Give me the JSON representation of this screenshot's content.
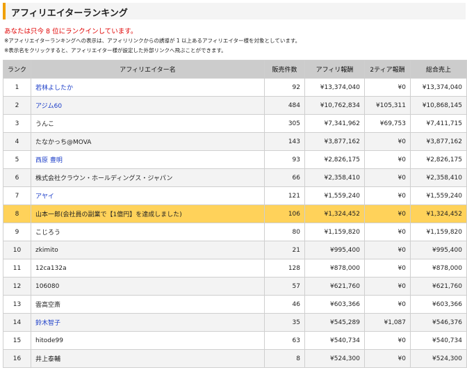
{
  "header": {
    "title": "アフィリエイターランキング",
    "rank_message": "あなたは只今 8 位にランクインしています。",
    "note1": "※アフィリエイターランキングへの表示は、アフィリリンクからの誘導が 1 以上あるアフィリエイター様を対象としています。",
    "note2": "※表示名をクリックすると、アフィリエイター様が設定した外部リンクへ飛ぶことができます。"
  },
  "table": {
    "columns": [
      "ランク",
      "アフィリエイター名",
      "販売件数",
      "アフィリ報酬",
      "2ティア報酬",
      "総合売上"
    ],
    "highlight_rank": "8",
    "colors": {
      "header_bg": "#cccccc",
      "highlight_bg": "#ffd25a",
      "link": "#1a3cc8",
      "accent": "#f0a000",
      "rank_message": "#e00000"
    },
    "rows": [
      {
        "rank": "1",
        "name": "若林よしたか",
        "is_link": true,
        "sales": "92",
        "affiliate": "¥13,374,040",
        "tier2": "¥0",
        "total": "¥13,374,040"
      },
      {
        "rank": "2",
        "name": "アジム60",
        "is_link": true,
        "sales": "484",
        "affiliate": "¥10,762,834",
        "tier2": "¥105,311",
        "total": "¥10,868,145"
      },
      {
        "rank": "3",
        "name": "うんこ",
        "is_link": false,
        "sales": "305",
        "affiliate": "¥7,341,962",
        "tier2": "¥69,753",
        "total": "¥7,411,715"
      },
      {
        "rank": "4",
        "name": "たなかっち@MOVA",
        "is_link": false,
        "sales": "143",
        "affiliate": "¥3,877,162",
        "tier2": "¥0",
        "total": "¥3,877,162"
      },
      {
        "rank": "5",
        "name": "西原 豊明",
        "is_link": true,
        "sales": "93",
        "affiliate": "¥2,826,175",
        "tier2": "¥0",
        "total": "¥2,826,175"
      },
      {
        "rank": "6",
        "name": "株式会社クラウン・ホールディングス・ジャパン",
        "is_link": false,
        "sales": "66",
        "affiliate": "¥2,358,410",
        "tier2": "¥0",
        "total": "¥2,358,410"
      },
      {
        "rank": "7",
        "name": "アヤイ",
        "is_link": true,
        "sales": "121",
        "affiliate": "¥1,559,240",
        "tier2": "¥0",
        "total": "¥1,559,240"
      },
      {
        "rank": "8",
        "name": "山本一郎(会社員の副業で【1億円】を達成しました)",
        "is_link": false,
        "sales": "106",
        "affiliate": "¥1,324,452",
        "tier2": "¥0",
        "total": "¥1,324,452"
      },
      {
        "rank": "9",
        "name": "こじろう",
        "is_link": false,
        "sales": "80",
        "affiliate": "¥1,159,820",
        "tier2": "¥0",
        "total": "¥1,159,820"
      },
      {
        "rank": "10",
        "name": "zkimito",
        "is_link": false,
        "sales": "21",
        "affiliate": "¥995,400",
        "tier2": "¥0",
        "total": "¥995,400"
      },
      {
        "rank": "11",
        "name": "12ca132a",
        "is_link": false,
        "sales": "128",
        "affiliate": "¥878,000",
        "tier2": "¥0",
        "total": "¥878,000"
      },
      {
        "rank": "12",
        "name": "106080",
        "is_link": false,
        "sales": "57",
        "affiliate": "¥621,760",
        "tier2": "¥0",
        "total": "¥621,760"
      },
      {
        "rank": "13",
        "name": "雲高空斎",
        "is_link": false,
        "sales": "46",
        "affiliate": "¥603,366",
        "tier2": "¥0",
        "total": "¥603,366"
      },
      {
        "rank": "14",
        "name": "鈴木智子",
        "is_link": true,
        "sales": "35",
        "affiliate": "¥545,289",
        "tier2": "¥1,087",
        "total": "¥546,376"
      },
      {
        "rank": "15",
        "name": "hitode99",
        "is_link": false,
        "sales": "63",
        "affiliate": "¥540,734",
        "tier2": "¥0",
        "total": "¥540,734"
      },
      {
        "rank": "16",
        "name": "井上泰輔",
        "is_link": false,
        "sales": "8",
        "affiliate": "¥524,300",
        "tier2": "¥0",
        "total": "¥524,300"
      }
    ]
  }
}
